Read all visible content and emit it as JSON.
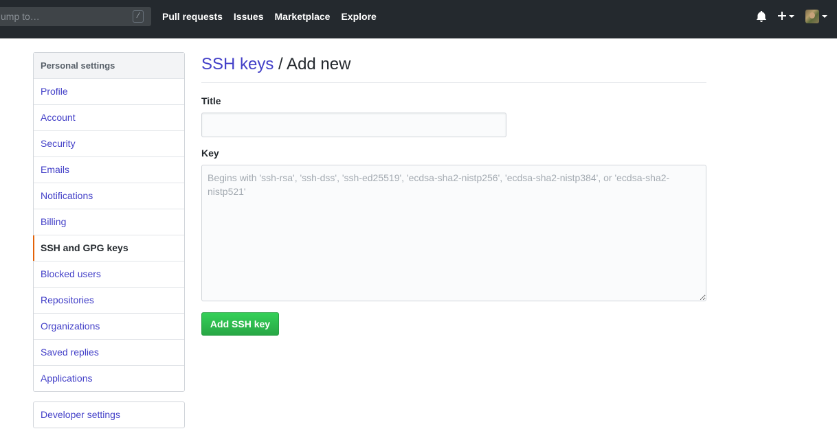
{
  "header": {
    "search_placeholder": "Jump to…",
    "search_shortcut": "/",
    "nav": [
      "Pull requests",
      "Issues",
      "Marketplace",
      "Explore"
    ],
    "icons": [
      "bell-icon",
      "plus-icon",
      "avatar"
    ]
  },
  "sidebar": {
    "heading": "Personal settings",
    "items": [
      {
        "label": "Profile"
      },
      {
        "label": "Account"
      },
      {
        "label": "Security"
      },
      {
        "label": "Emails"
      },
      {
        "label": "Notifications"
      },
      {
        "label": "Billing"
      },
      {
        "label": "SSH and GPG keys",
        "selected": true
      },
      {
        "label": "Blocked users"
      },
      {
        "label": "Repositories"
      },
      {
        "label": "Organizations"
      },
      {
        "label": "Saved replies"
      },
      {
        "label": "Applications"
      }
    ],
    "developer_settings": "Developer settings"
  },
  "main": {
    "breadcrumb_link": "SSH keys",
    "breadcrumb_rest": " / Add new",
    "title_label": "Title",
    "title_value": "",
    "key_label": "Key",
    "key_placeholder": "Begins with 'ssh-rsa', 'ssh-dss', 'ssh-ed25519', 'ecdsa-sha2-nistp256', 'ecdsa-sha2-nistp384', or 'ecdsa-sha2-nistp521'",
    "key_value": "",
    "submit_label": "Add SSH key"
  },
  "colors": {
    "header_bg": "#24292e",
    "link": "#4340c8",
    "selected_marker": "#e36209",
    "button_green": "#28a745"
  }
}
